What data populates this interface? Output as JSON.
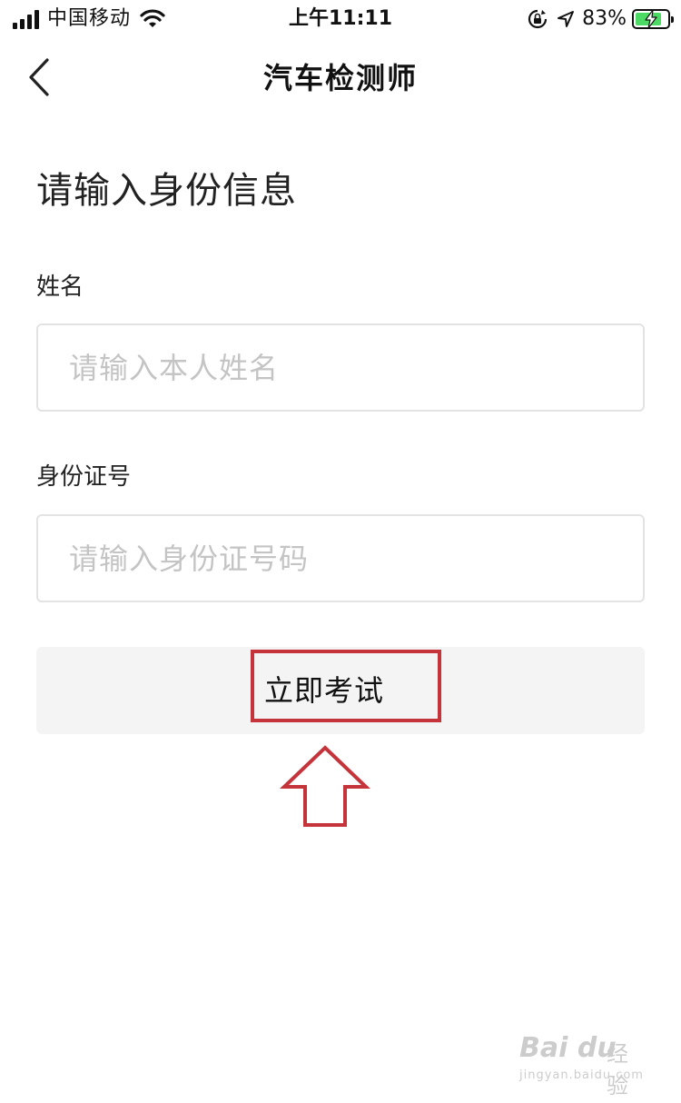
{
  "status_bar": {
    "carrier": "中国移动",
    "time": "上午11:11",
    "battery_percent": "83%",
    "battery_level": 0.83,
    "icons": [
      "signal-icon",
      "wifi-icon",
      "orientation-lock-icon",
      "location-icon",
      "battery-icon",
      "charging-bolt-icon"
    ]
  },
  "nav": {
    "title": "汽车检测师",
    "back_icon": "chevron-left-icon"
  },
  "form": {
    "heading": "请输入身份信息",
    "name_label": "姓名",
    "name_placeholder": "请输入本人姓名",
    "id_label": "身份证号",
    "id_placeholder": "请输入身份证号码",
    "submit_label": "立即考试"
  },
  "annotation": {
    "highlight_color": "#c4343a",
    "arrow_icon": "up-arrow-outline-icon"
  },
  "watermark": {
    "logo": "Bai du",
    "text": "经验",
    "url": "jingyan.baidu.com"
  },
  "colors": {
    "background": "#ffffff",
    "input_border": "#e3e3e3",
    "placeholder": "#c4c4c4",
    "button_bg": "#f4f4f4",
    "battery_fill": "#4cd964"
  }
}
